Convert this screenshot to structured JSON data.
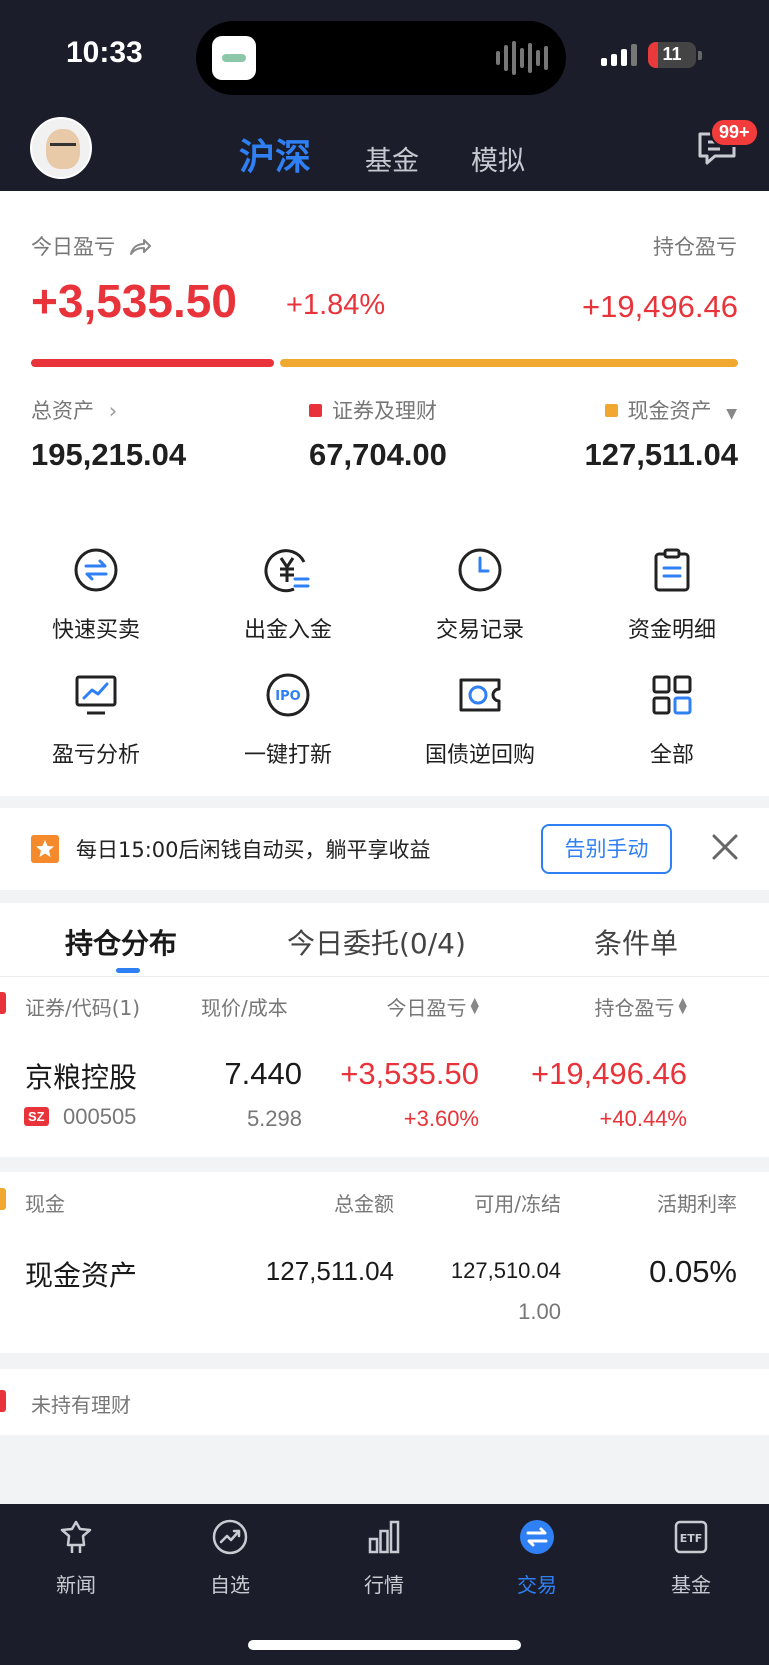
{
  "status_bar": {
    "time": "10:33",
    "battery": "11",
    "battery_level": 0.11
  },
  "header": {
    "tabs": [
      {
        "label": "沪深",
        "active": true
      },
      {
        "label": "基金",
        "active": false
      },
      {
        "label": "模拟",
        "active": false
      }
    ],
    "message_badge": "99+"
  },
  "summary": {
    "today_pnl_label": "今日盈亏",
    "today_pnl_value": "+3,535.50",
    "today_pnl_pct": "+1.84%",
    "position_pnl_label": "持仓盈亏",
    "position_pnl_value": "+19,496.46",
    "total_assets_label": "总资产",
    "total_assets_value": "195,215.04",
    "securities_label": "证券及理财",
    "securities_value": "67,704.00",
    "cash_label": "现金资产",
    "cash_value": "127,511.04",
    "securities_share": 0.347,
    "colors": {
      "securities": "#e8333a",
      "cash": "#f0a830"
    }
  },
  "grid": {
    "items": [
      {
        "label": "快速买卖",
        "icon": "swap-icon"
      },
      {
        "label": "出金入金",
        "icon": "yuan-transfer-icon"
      },
      {
        "label": "交易记录",
        "icon": "clock-icon"
      },
      {
        "label": "资金明细",
        "icon": "clipboard-icon"
      },
      {
        "label": "盈亏分析",
        "icon": "chart-monitor-icon"
      },
      {
        "label": "一键打新",
        "icon": "ipo-icon"
      },
      {
        "label": "国债逆回购",
        "icon": "ticket-icon"
      },
      {
        "label": "全部",
        "icon": "grid-icon"
      }
    ]
  },
  "promo": {
    "text": "每日15:00后闲钱自动买，躺平享收益",
    "button": "告别手动"
  },
  "positions": {
    "tabs": [
      {
        "label": "持仓分布",
        "active": true
      },
      {
        "label": "今日委托(0/4)",
        "active": false
      },
      {
        "label": "条件单",
        "active": false
      }
    ],
    "columns": [
      "证券/代码(1)",
      "现价/成本",
      "今日盈亏",
      "持仓盈亏"
    ],
    "rows": [
      {
        "name": "京粮控股",
        "market": "SZ",
        "code": "000505",
        "price": "7.440",
        "cost": "5.298",
        "today_pnl": "+3,535.50",
        "today_pct": "+3.60%",
        "hold_pnl": "+19,496.46",
        "hold_pct": "+40.44%"
      }
    ]
  },
  "cash": {
    "columns": [
      "现金",
      "总金额",
      "可用/冻结",
      "活期利率"
    ],
    "row": {
      "name": "现金资产",
      "total": "127,511.04",
      "available": "127,510.04",
      "frozen": "1.00",
      "rate": "0.05%"
    }
  },
  "no_hold": {
    "label": "未持有理财"
  },
  "bottom_nav": {
    "items": [
      {
        "label": "新闻",
        "icon": "news-icon",
        "active": false
      },
      {
        "label": "自选",
        "icon": "trend-icon",
        "active": false
      },
      {
        "label": "行情",
        "icon": "bars-icon",
        "active": false
      },
      {
        "label": "交易",
        "icon": "trade-icon",
        "active": true
      },
      {
        "label": "基金",
        "icon": "etf-icon",
        "active": false
      }
    ]
  }
}
